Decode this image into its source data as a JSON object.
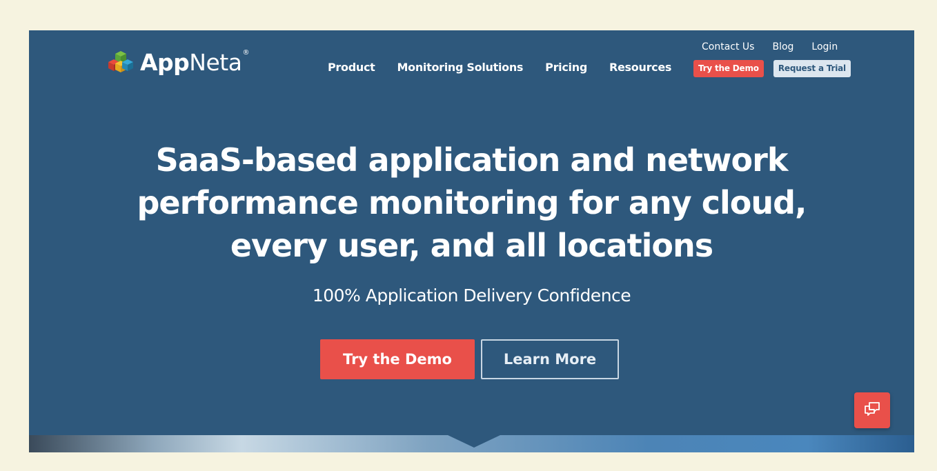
{
  "brand": {
    "name_bold": "App",
    "name_regular": "Neta",
    "registered": "®"
  },
  "main_nav": {
    "items": [
      {
        "label": "Product"
      },
      {
        "label": "Monitoring Solutions"
      },
      {
        "label": "Pricing"
      },
      {
        "label": "Resources"
      }
    ]
  },
  "util_nav": {
    "items": [
      {
        "label": "Contact Us"
      },
      {
        "label": "Blog"
      },
      {
        "label": "Login"
      }
    ],
    "try_demo_label": "Try the Demo",
    "request_trial_label": "Request a Trial"
  },
  "hero": {
    "title_lines": [
      "SaaS-based application and network",
      "performance monitoring for any cloud,",
      "every user, and all locations"
    ],
    "subtitle": "100% Application Delivery Confidence",
    "primary_cta": "Try the Demo",
    "secondary_cta": "Learn More"
  },
  "chat": {
    "icon": "chat-bubbles-icon"
  },
  "colors": {
    "background": "#2e587c",
    "accent": "#e9504a",
    "page_bg": "#f6f3e0"
  }
}
